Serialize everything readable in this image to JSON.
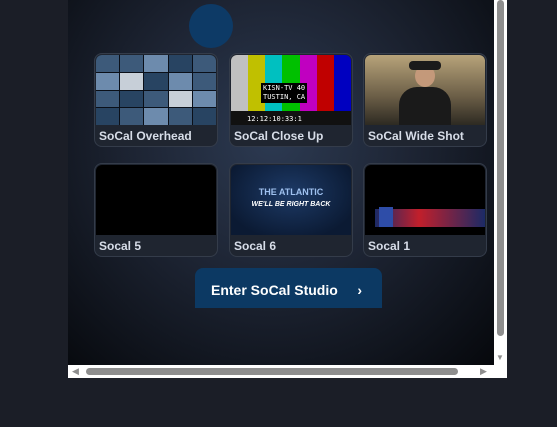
{
  "tiles": [
    {
      "label": "SoCal Overhead"
    },
    {
      "label": "SoCal Close Up",
      "overlay_lines": [
        "KISN-TV 40",
        "TUSTIN, CA"
      ],
      "timecode": "12:12:10:33:1"
    },
    {
      "label": "SoCal Wide Shot"
    },
    {
      "label": "Socal 5"
    },
    {
      "label": "Socal 6",
      "title": "THE ATLANTIC",
      "subtitle": "WE'LL BE RIGHT BACK"
    },
    {
      "label": "Socal 1"
    }
  ],
  "enter_button": {
    "label": "Enter SoCal Studio",
    "icon": "chevron-right-icon"
  },
  "colors": {
    "page_bg": "#1b1e27",
    "tile_bg": "#1f2530",
    "button_bg": "#0c3963",
    "avatar": "#0d3a66",
    "scrollbar": "#8e8e8e"
  },
  "color_bars": [
    "#c0c0c0",
    "#c0c000",
    "#00c0c0",
    "#00c000",
    "#c000c0",
    "#c00000",
    "#0000c0"
  ]
}
